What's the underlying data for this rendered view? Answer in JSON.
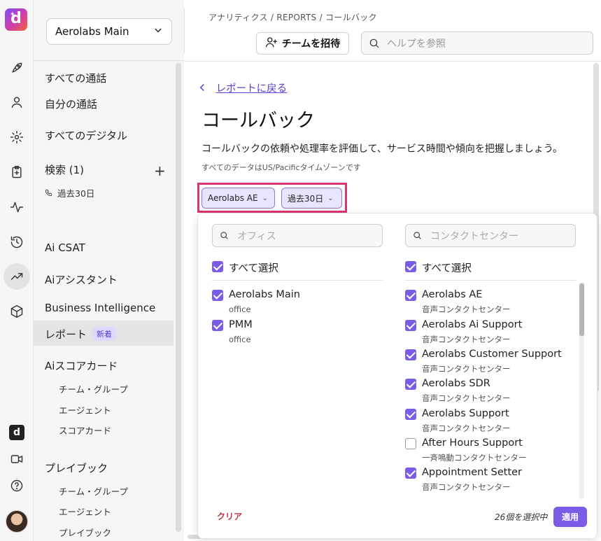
{
  "rail": {
    "icons": [
      "rocket-icon",
      "person-icon",
      "gear-icon",
      "clipboard-icon",
      "activity-icon",
      "history-icon",
      "trend-icon",
      "cube-icon"
    ],
    "bottom_icons": [
      "app-logo-icon",
      "video-icon",
      "help-icon",
      "avatar"
    ]
  },
  "sidebar": {
    "org_select": "Aerolabs Main",
    "items": {
      "all_calls": "すべての通話",
      "my_calls": "自分の通話",
      "all_digital": "すべてのデジタル",
      "search": "検索 (1)",
      "search_sub": "過去30日",
      "ai_csat": "Ai CSAT",
      "ai_assistant": "Aiアシスタント",
      "bi": "Business Intelligence",
      "reports": "レポート",
      "reports_badge": "新着",
      "ai_scorecard": "Aiスコアカード",
      "sc_team_group": "チーム・グループ",
      "sc_agent": "エージェント",
      "sc_scorecard": "スコアカード",
      "playbook": "プレイブック",
      "pb_team_group": "チーム・グループ",
      "pb_agent": "エージェント",
      "pb_playbook": "プレイブック"
    }
  },
  "header": {
    "breadcrumb": "アナリティクス / REPORTS / コールバック",
    "invite_label": "チームを招待",
    "help_placeholder": "ヘルプを参照"
  },
  "main": {
    "back_label": "レポートに戻る",
    "title": "コールバック",
    "description": "コールバックの依頼や処理率を評価して、サービス時間や傾向を把握しましょう。",
    "tz_note": "すべてのデータはUS/Pacificタイムゾーンです",
    "filters": {
      "office_chip": "Aerolabs AE",
      "date_chip": "過去30日"
    }
  },
  "panel": {
    "office_search_placeholder": "オフィス",
    "cc_search_placeholder": "コンタクトセンター",
    "select_all": "すべて選択",
    "offices": [
      {
        "name": "Aerolabs Main",
        "type": "office",
        "checked": true
      },
      {
        "name": "PMM",
        "type": "office",
        "checked": true
      }
    ],
    "contact_centers": [
      {
        "name": "Aerolabs AE",
        "type": "音声コンタクトセンター",
        "checked": true
      },
      {
        "name": "Aerolabs Ai Support",
        "type": "音声コンタクトセンター",
        "checked": true
      },
      {
        "name": "Aerolabs Customer Support",
        "type": "音声コンタクトセンター",
        "checked": true
      },
      {
        "name": "Aerolabs SDR",
        "type": "音声コンタクトセンター",
        "checked": true
      },
      {
        "name": "Aerolabs Support",
        "type": "音声コンタクトセンター",
        "checked": true
      },
      {
        "name": "After Hours Support",
        "type": "一斉鳴動コンタクトセンター",
        "checked": false
      },
      {
        "name": "Appointment Setter",
        "type": "音声コンタクトセンター",
        "checked": true
      }
    ],
    "clear_label": "クリア",
    "selected_count": "26個を選択中",
    "apply_label": "適用"
  },
  "colors": {
    "accent": "#7b5ce6",
    "highlight_border": "#d9356f",
    "link": "#5b3fd0",
    "clear": "#c0304a"
  }
}
